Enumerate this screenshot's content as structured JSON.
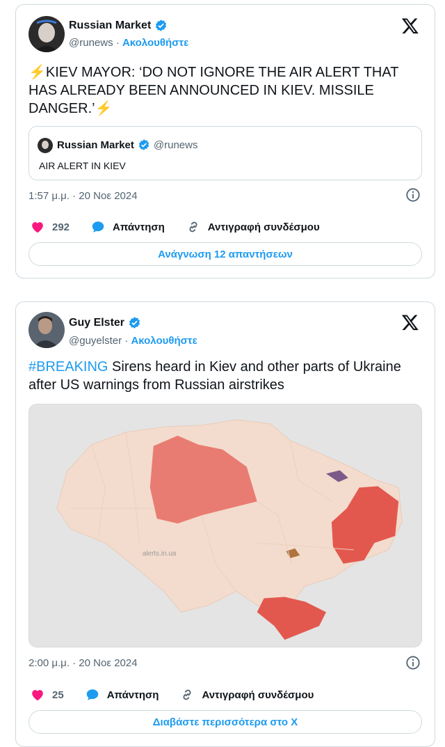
{
  "tweets": [
    {
      "author": "Russian Market",
      "handle": "@runews",
      "separator": "·",
      "follow": "Ακολουθήστε",
      "text": "⚡KIEV MAYOR: ‘DO NOT IGNORE THE AIR ALERT THAT HAS ALREADY BEEN ANNOUNCED IN KIEV.  MISSILE DANGER.’⚡",
      "quote": {
        "author": "Russian Market",
        "handle": "@runews",
        "text": "AIR ALERT IN KIEV"
      },
      "timestamp": "1:57 μ.μ. · 20 Νοε 2024",
      "likes": "292",
      "reply_label": "Απάντηση",
      "copy_label": "Αντιγραφή συνδέσμου",
      "button_label": "Ανάγνωση 12 απαντήσεων"
    },
    {
      "author": "Guy Elster",
      "handle": "@guyelster",
      "separator": "·",
      "follow": "Ακολουθήστε",
      "hashtag": "#BREAKING",
      "text": " Sirens heard in Kiev and other parts of Ukraine after US warnings from Russian airstrikes",
      "map_watermark": "alerts.in.ua",
      "timestamp": "2:00 μ.μ. · 20 Νοε 2024",
      "likes": "25",
      "reply_label": "Απάντηση",
      "copy_label": "Αντιγραφή συνδέσμου",
      "button_label": "Διαβάστε περισσότερα στο X"
    }
  ],
  "colors": {
    "accent": "#1d9bf0",
    "like": "#f91880",
    "alert_region": "#e8736a",
    "calm_region": "#f3dccd"
  },
  "icons": [
    "verified-badge-icon",
    "x-logo-icon",
    "info-icon",
    "heart-icon",
    "reply-bubble-icon",
    "link-icon"
  ]
}
